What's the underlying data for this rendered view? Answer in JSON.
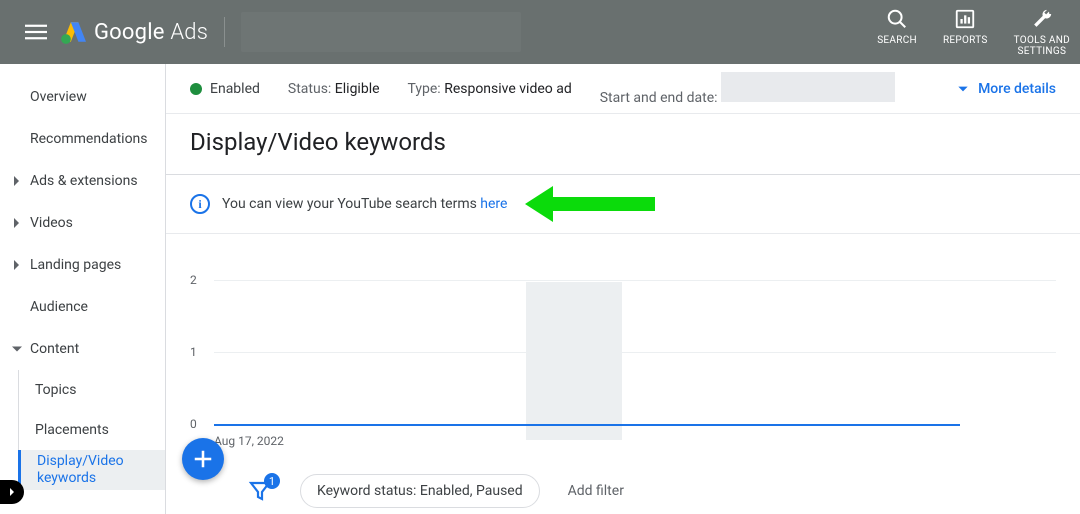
{
  "header": {
    "brand_g": "Google",
    "brand_a": "Ads",
    "actions": {
      "search": "SEARCH",
      "reports": "REPORTS",
      "tools": "TOOLS AND\nSETTINGS"
    }
  },
  "sidebar": {
    "overview": "Overview",
    "recommendations": "Recommendations",
    "ads_ext": "Ads & extensions",
    "videos": "Videos",
    "landing": "Landing pages",
    "audience": "Audience",
    "content": "Content",
    "sub": {
      "topics": "Topics",
      "placements": "Placements",
      "dvk": "Display/Video keywords"
    }
  },
  "status": {
    "enabled": "Enabled",
    "status_k": "Status:",
    "status_v": "Eligible",
    "type_k": "Type:",
    "type_v": "Responsive video ad",
    "date_k": "Start and end date:",
    "more": "More details"
  },
  "page_title": "Display/Video keywords",
  "banner": {
    "text": "You can view your YouTube search terms ",
    "link": "here"
  },
  "chart_data": {
    "type": "line",
    "yticks": [
      2,
      1,
      0
    ],
    "ylim": [
      0,
      2
    ],
    "x_start_label": "Aug 17, 2022",
    "series": [
      {
        "name": "primary",
        "values": [
          0
        ],
        "color": "#1a73e8"
      }
    ]
  },
  "filters": {
    "badge": "1",
    "pill": "Keyword status: Enabled, Paused",
    "add": "Add filter"
  }
}
